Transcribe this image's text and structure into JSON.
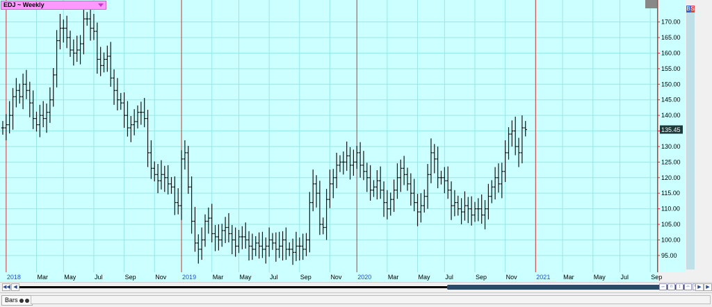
{
  "header": {
    "title": "EDJ ~ Weekly",
    "dropdown_icon": "chevron-down-icon"
  },
  "badge": {
    "b": "B",
    "s": "S",
    "b_color": "#3366cc",
    "s_color": "#dd4444"
  },
  "status": {
    "tab_label": "Bars"
  },
  "colors": {
    "background": "#ccffff",
    "grid": "#99e6e6",
    "bars": "#111111",
    "axis_line": "#cc3333",
    "year_label": "#1a4fcc"
  },
  "chart_data": {
    "type": "ohlc",
    "title": "EDJ ~ Weekly",
    "xlabel": "",
    "ylabel": "",
    "y_ticks": [
      95,
      100,
      105,
      110,
      115,
      120,
      125,
      130,
      135,
      140,
      145,
      150,
      155,
      160,
      165,
      170
    ],
    "y_tick_labels": [
      "95.00",
      "100.00",
      "105.00",
      "110.00",
      "115.00",
      "120.00",
      "125.00",
      "130.00",
      "135.00",
      "140.00",
      "145.00",
      "150.00",
      "155.00",
      "160.00",
      "165.00",
      "170.00"
    ],
    "ylim": [
      90.5,
      175.5
    ],
    "last_price": "135.45",
    "x_ticks": [
      {
        "label": "2018",
        "year": true,
        "i": 1
      },
      {
        "label": "Mar",
        "year": false,
        "i": 10
      },
      {
        "label": "May",
        "year": false,
        "i": 18
      },
      {
        "label": "Jul",
        "year": false,
        "i": 27
      },
      {
        "label": "Sep",
        "year": false,
        "i": 36
      },
      {
        "label": "Nov",
        "year": false,
        "i": 45
      },
      {
        "label": "2019",
        "year": true,
        "i": 53
      },
      {
        "label": "Mar",
        "year": false,
        "i": 62
      },
      {
        "label": "May",
        "year": false,
        "i": 70
      },
      {
        "label": "Jul",
        "year": false,
        "i": 79
      },
      {
        "label": "Sep",
        "year": false,
        "i": 88
      },
      {
        "label": "Nov",
        "year": false,
        "i": 97
      },
      {
        "label": "2020",
        "year": true,
        "i": 105
      },
      {
        "label": "Mar",
        "year": false,
        "i": 114
      },
      {
        "label": "May",
        "year": false,
        "i": 123
      },
      {
        "label": "Jul",
        "year": false,
        "i": 131
      },
      {
        "label": "Sep",
        "year": false,
        "i": 140
      },
      {
        "label": "Nov",
        "year": false,
        "i": 149
      },
      {
        "label": "2021",
        "year": true,
        "i": 158
      },
      {
        "label": "Mar",
        "year": false,
        "i": 166
      },
      {
        "label": "May",
        "year": false,
        "i": 175
      },
      {
        "label": "Jul",
        "year": false,
        "i": 183
      },
      {
        "label": "Sep",
        "year": false,
        "i": 192
      }
    ],
    "series": [
      {
        "close": [
          136,
          137,
          140,
          146,
          148,
          146,
          150,
          148,
          144,
          139,
          137,
          140,
          139,
          141,
          145,
          153,
          164,
          168,
          168,
          165,
          161,
          160,
          161,
          163,
          171,
          171,
          168,
          167,
          158,
          156,
          158,
          159,
          152,
          148,
          145,
          144,
          140,
          136,
          137,
          138,
          141,
          141,
          139,
          128,
          123,
          121,
          119,
          121,
          120,
          118,
          117,
          112,
          111,
          126,
          128,
          117,
          106,
          99,
          97,
          100,
          106,
          107,
          102,
          101,
          100,
          103,
          104,
          102,
          100,
          98,
          101,
          101,
          100,
          98,
          97,
          99,
          98,
          97,
          98,
          100,
          99,
          97,
          98,
          100,
          97,
          97,
          96,
          98,
          98,
          97,
          100,
          112,
          118,
          115,
          105,
          104,
          113,
          118,
          120,
          124,
          125,
          125,
          127,
          124,
          125,
          128,
          124,
          122,
          120,
          116,
          117,
          119,
          116,
          112,
          110,
          113,
          116,
          120,
          123,
          121,
          118,
          115,
          112,
          109,
          111,
          114,
          121,
          128,
          126,
          120,
          120,
          119,
          116,
          111,
          112,
          110,
          109,
          111,
          110,
          108,
          110,
          110,
          108,
          110,
          114,
          117,
          120,
          118,
          122,
          128,
          134,
          135,
          130,
          128,
          136,
          135.45
        ],
        "name": ""
      }
    ]
  }
}
